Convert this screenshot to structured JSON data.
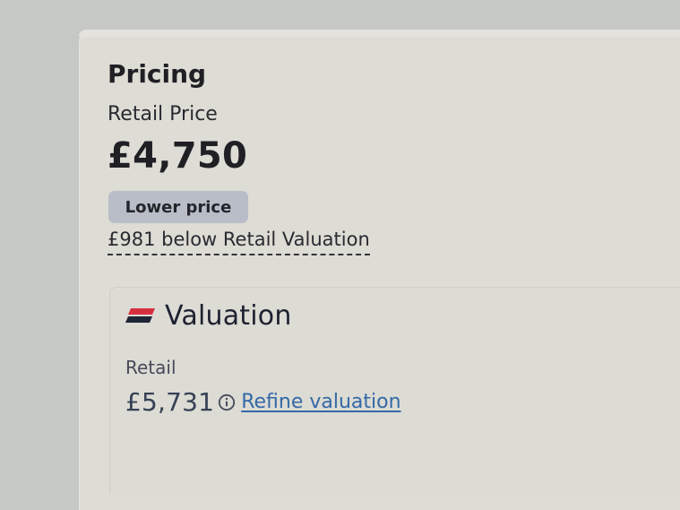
{
  "pricing": {
    "title": "Pricing",
    "retail_price_label": "Retail Price",
    "price": "£4,750",
    "badge": "Lower price",
    "below_retail_text": "£981 below Retail Valuation"
  },
  "valuation": {
    "brand_label": "Valuation",
    "retail_label": "Retail",
    "retail_value": "£5,731",
    "refine_link": "Refine valuation"
  },
  "icons": {
    "logo": "valuation-logo",
    "info": "info-icon"
  },
  "colors": {
    "brand_red": "#d6303f",
    "brand_dark": "#1e2536",
    "link_blue": "#3569a6",
    "badge_bg": "#b9bdc7"
  }
}
